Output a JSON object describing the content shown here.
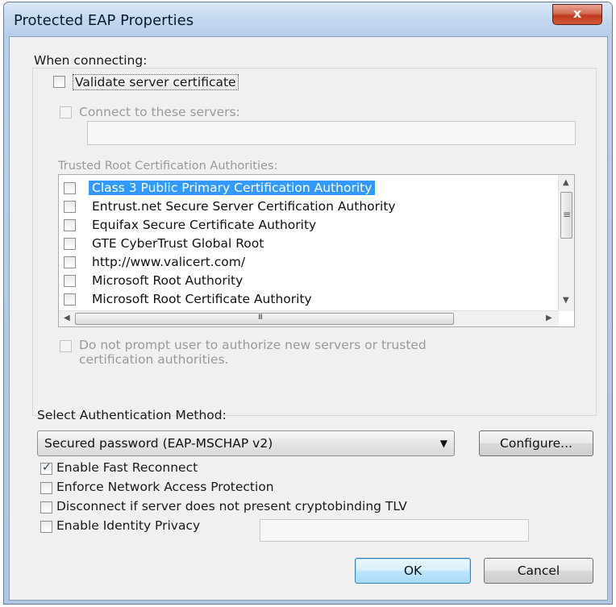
{
  "window": {
    "title": "Protected EAP Properties",
    "close_glyph": "x"
  },
  "connecting": {
    "group_label": "When connecting:",
    "validate_cert": {
      "label": "Validate server certificate",
      "checked": false
    },
    "connect_servers": {
      "label": "Connect to these servers:",
      "checked": false,
      "value": ""
    },
    "trusted_root_label": "Trusted Root Certification Authorities:",
    "authorities": [
      {
        "label": "Class 3 Public Primary Certification Authority",
        "checked": false,
        "selected": true
      },
      {
        "label": "Entrust.net Secure Server Certification Authority",
        "checked": false,
        "selected": false
      },
      {
        "label": "Equifax Secure Certificate Authority",
        "checked": false,
        "selected": false
      },
      {
        "label": "GTE CyberTrust Global Root",
        "checked": false,
        "selected": false
      },
      {
        "label": "http://www.valicert.com/",
        "checked": false,
        "selected": false
      },
      {
        "label": "Microsoft Root Authority",
        "checked": false,
        "selected": false
      },
      {
        "label": "Microsoft Root Certificate Authority",
        "checked": false,
        "selected": false
      }
    ],
    "no_prompt": {
      "line1": "Do not prompt user to authorize new servers or trusted",
      "line2": "certification authorities.",
      "checked": false
    }
  },
  "auth": {
    "label": "Select Authentication Method:",
    "selected_method": "Secured password (EAP-MSCHAP v2)",
    "configure_label": "Configure..."
  },
  "options": {
    "fast_reconnect": {
      "label": "Enable Fast Reconnect",
      "checked": true
    },
    "nap": {
      "label": "Enforce Network Access Protection",
      "checked": false
    },
    "cryptobinding": {
      "label": "Disconnect if server does not present cryptobinding TLV",
      "checked": false
    },
    "identity_privacy": {
      "label": "Enable Identity Privacy",
      "checked": false,
      "value": ""
    }
  },
  "buttons": {
    "ok": "OK",
    "cancel": "Cancel"
  },
  "icons": {
    "check": "✓",
    "combo_arrow": "▼",
    "scroll_up": "▲",
    "scroll_down": "▼",
    "scroll_left": "◀",
    "scroll_right": "▶",
    "thumb_grip": "≡",
    "thumb_grip_h": "III"
  }
}
